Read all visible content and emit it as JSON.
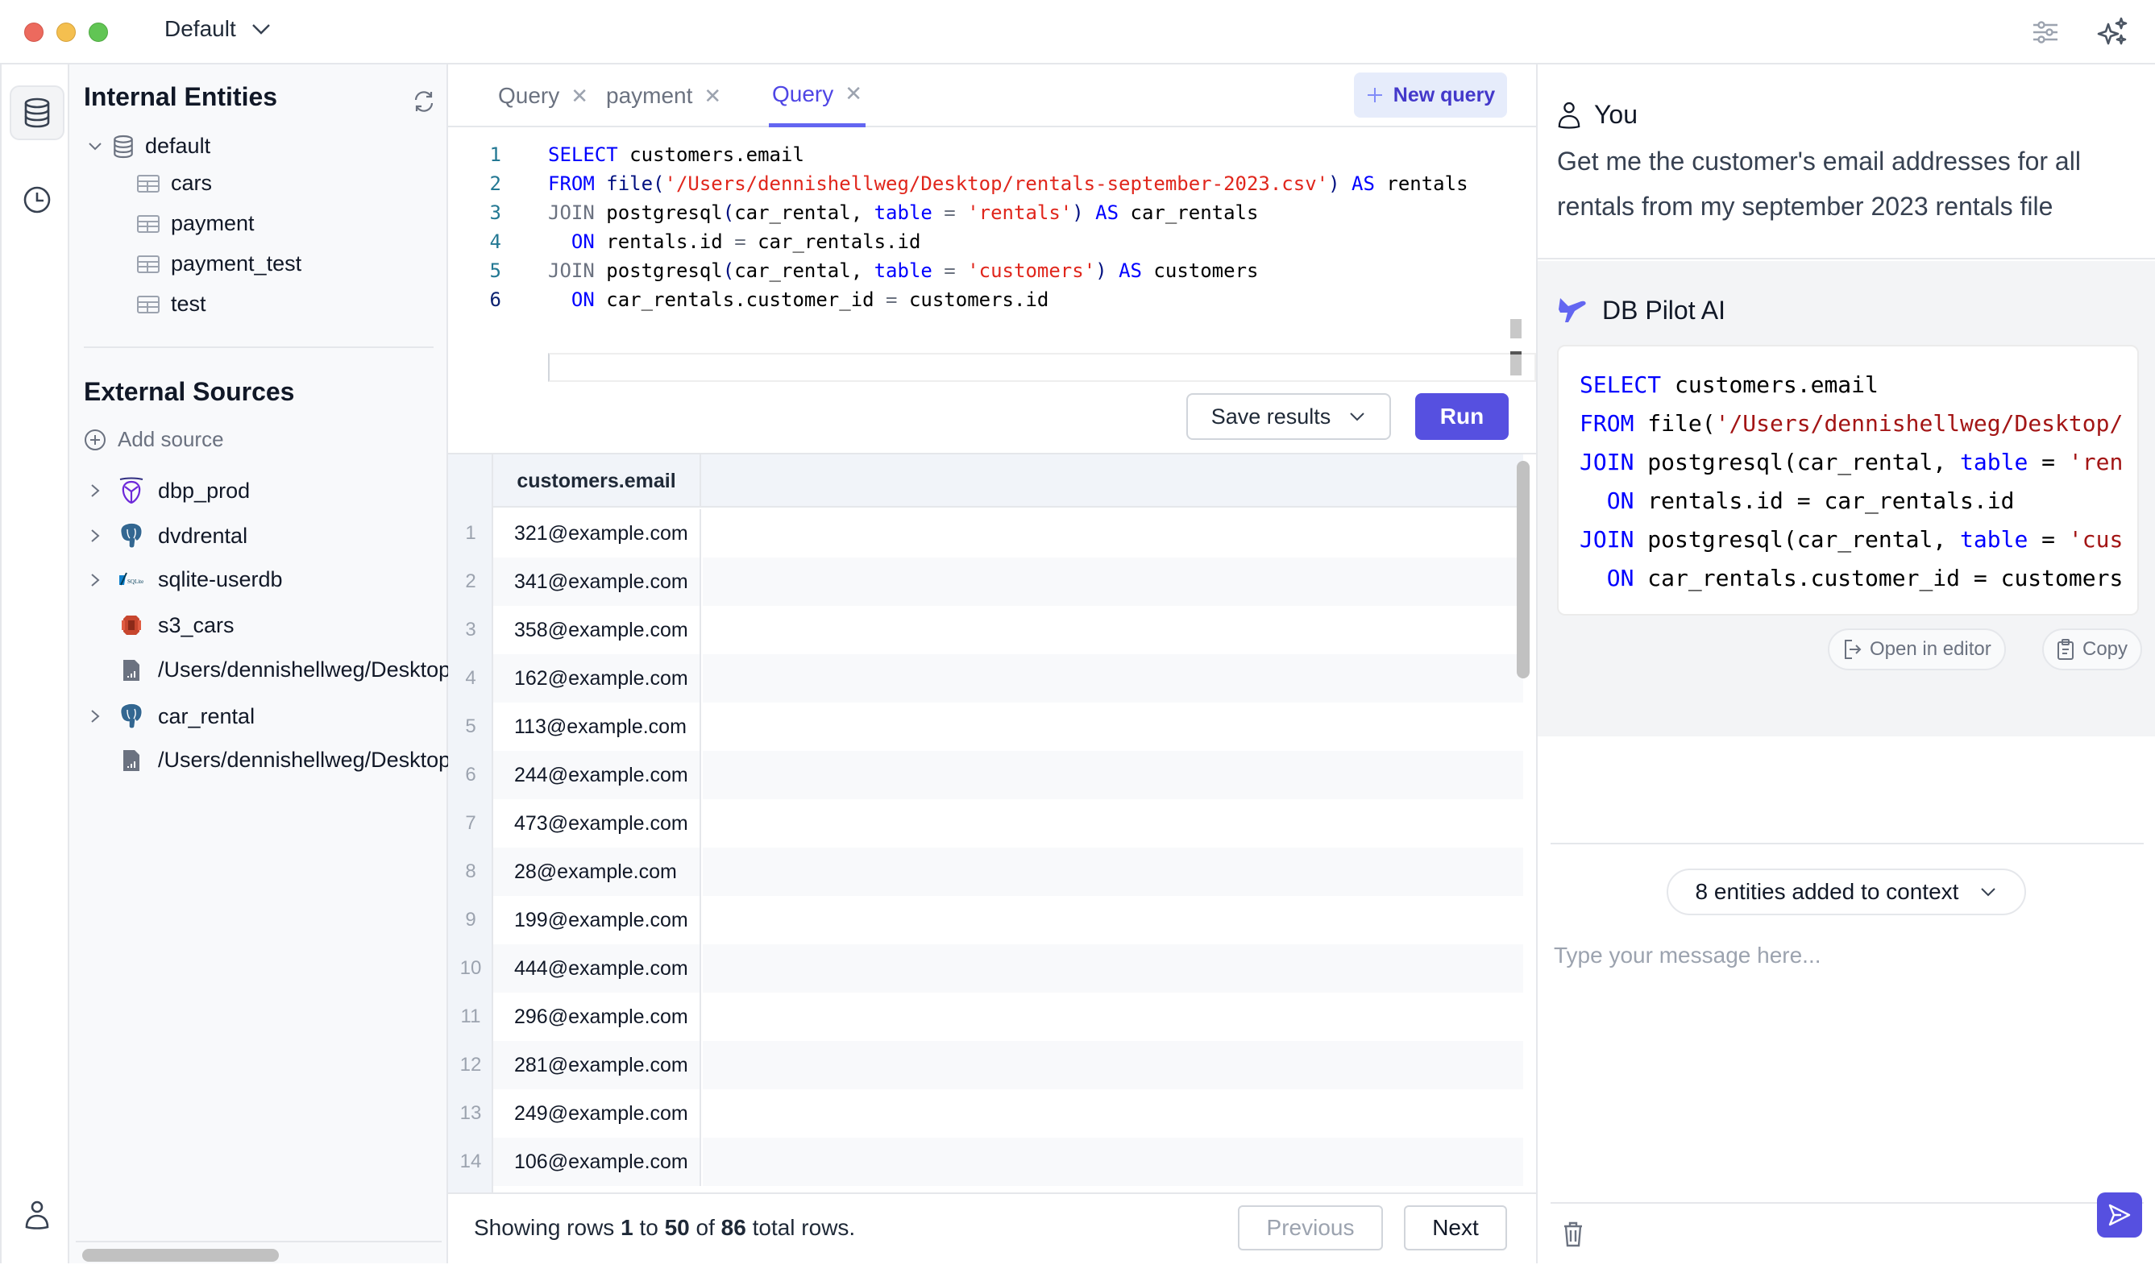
{
  "titlebar": {
    "workspace": "Default",
    "icons": [
      "sliders-icon",
      "sparkles-icon"
    ]
  },
  "rail": {
    "items": [
      {
        "name": "database-icon",
        "active": true
      },
      {
        "name": "history-icon",
        "active": false
      },
      {
        "name": "user-icon",
        "active": false
      }
    ]
  },
  "sidebar": {
    "internal_title": "Internal Entities",
    "internal_root": "default",
    "internal_tables": [
      "cars",
      "payment",
      "payment_test",
      "test"
    ],
    "external_title": "External Sources",
    "add_source": "Add source",
    "external_sources": [
      {
        "label": "dbp_prod",
        "icon": "dbpilot-icon",
        "expandable": true
      },
      {
        "label": "dvdrental",
        "icon": "postgres-icon",
        "expandable": true
      },
      {
        "label": "sqlite-userdb",
        "icon": "sqlite-icon",
        "expandable": true
      },
      {
        "label": "s3_cars",
        "icon": "s3-icon",
        "expandable": false
      },
      {
        "label": "/Users/dennishellweg/Desktop/c",
        "icon": "csv-file-icon",
        "expandable": false
      },
      {
        "label": "car_rental",
        "icon": "postgres-icon",
        "expandable": true
      },
      {
        "label": "/Users/dennishellweg/Desktop/r",
        "icon": "csv-file-icon",
        "expandable": false
      }
    ]
  },
  "tabs": [
    {
      "label": "Query",
      "active": false
    },
    {
      "label": "payment",
      "active": false
    },
    {
      "label": "Query",
      "active": true
    }
  ],
  "new_query": "New query",
  "editor": {
    "current_line": 6,
    "lines": [
      [
        [
          "kw",
          "SELECT"
        ],
        [
          "pl",
          " customers.email"
        ]
      ],
      [
        [
          "kw",
          "FROM"
        ],
        [
          "pl",
          " "
        ],
        [
          "fn",
          "file("
        ],
        [
          "str",
          "'/Users/dennishellweg/Desktop/rentals-september-2023.csv'"
        ],
        [
          "fn",
          ")"
        ],
        [
          "pl",
          " "
        ],
        [
          "kw",
          "AS"
        ],
        [
          "pl",
          " rentals"
        ]
      ],
      [
        [
          "kw2",
          "JOIN"
        ],
        [
          "pl",
          " postgresql"
        ],
        [
          "fn",
          "("
        ],
        [
          "pl",
          "car_rental, "
        ],
        [
          "kw",
          "table"
        ],
        [
          "kw2",
          " = "
        ],
        [
          "str",
          "'rentals'"
        ],
        [
          "fn",
          ")"
        ],
        [
          "pl",
          " "
        ],
        [
          "kw",
          "AS"
        ],
        [
          "pl",
          " car_rentals"
        ]
      ],
      [
        [
          "pl",
          "  "
        ],
        [
          "kw",
          "ON"
        ],
        [
          "pl",
          " rentals.id "
        ],
        [
          "kw2",
          "="
        ],
        [
          "pl",
          " car_rentals.id"
        ]
      ],
      [
        [
          "kw2",
          "JOIN"
        ],
        [
          "pl",
          " postgresql"
        ],
        [
          "fn",
          "("
        ],
        [
          "pl",
          "car_rental, "
        ],
        [
          "kw",
          "table"
        ],
        [
          "kw2",
          " = "
        ],
        [
          "str",
          "'customers'"
        ],
        [
          "fn",
          ")"
        ],
        [
          "pl",
          " "
        ],
        [
          "kw",
          "AS"
        ],
        [
          "pl",
          " customers"
        ]
      ],
      [
        [
          "pl",
          "  "
        ],
        [
          "kw",
          "ON"
        ],
        [
          "pl",
          " car_rentals.customer_id "
        ],
        [
          "kw2",
          "="
        ],
        [
          "pl",
          " customers.id"
        ]
      ]
    ]
  },
  "actions": {
    "save_results": "Save results",
    "run": "Run"
  },
  "results": {
    "column": "customers.email",
    "rows": [
      "321@example.com",
      "341@example.com",
      "358@example.com",
      "162@example.com",
      "113@example.com",
      "244@example.com",
      "473@example.com",
      "28@example.com",
      "199@example.com",
      "444@example.com",
      "296@example.com",
      "281@example.com",
      "249@example.com",
      "106@example.com"
    ],
    "footer": {
      "prefix": "Showing rows ",
      "from": "1",
      "to_word": " to ",
      "to": "50",
      "of_word": " of ",
      "total": "86",
      "suffix": " total rows."
    },
    "previous": "Previous",
    "next": "Next"
  },
  "chat": {
    "user_name": "You",
    "user_message": "Get me the customer's email addresses for all rentals from my september 2023 rentals file",
    "ai_name": "DB Pilot AI",
    "ai_code": [
      [
        [
          "kw",
          "SELECT"
        ],
        [
          "pl",
          " customers.email"
        ]
      ],
      [
        [
          "kw",
          "FROM"
        ],
        [
          "pl",
          " file("
        ],
        [
          "aistr",
          "'/Users/dennishellweg/Desktop/"
        ]
      ],
      [
        [
          "kw",
          "JOIN"
        ],
        [
          "pl",
          " postgresql(car_rental, "
        ],
        [
          "kw",
          "table"
        ],
        [
          "pl",
          " = "
        ],
        [
          "aistr",
          "'ren"
        ]
      ],
      [
        [
          "pl",
          "  "
        ],
        [
          "kw",
          "ON"
        ],
        [
          "pl",
          " rentals.id = car_rentals.id"
        ]
      ],
      [
        [
          "kw",
          "JOIN"
        ],
        [
          "pl",
          " postgresql(car_rental, "
        ],
        [
          "kw",
          "table"
        ],
        [
          "pl",
          " = "
        ],
        [
          "aistr",
          "'cus"
        ]
      ],
      [
        [
          "pl",
          "  "
        ],
        [
          "kw",
          "ON"
        ],
        [
          "pl",
          " car_rentals.customer_id = customers"
        ]
      ]
    ],
    "open_in_editor": "Open in editor",
    "copy": "Copy",
    "context_pill": "8 entities added to context",
    "input_placeholder": "Type your message here...",
    "input_value": ""
  },
  "colors": {
    "accent": "#5650e0",
    "accent_text": "#4f46e5",
    "keyword": "#0000ff",
    "string": "#e0261c"
  }
}
